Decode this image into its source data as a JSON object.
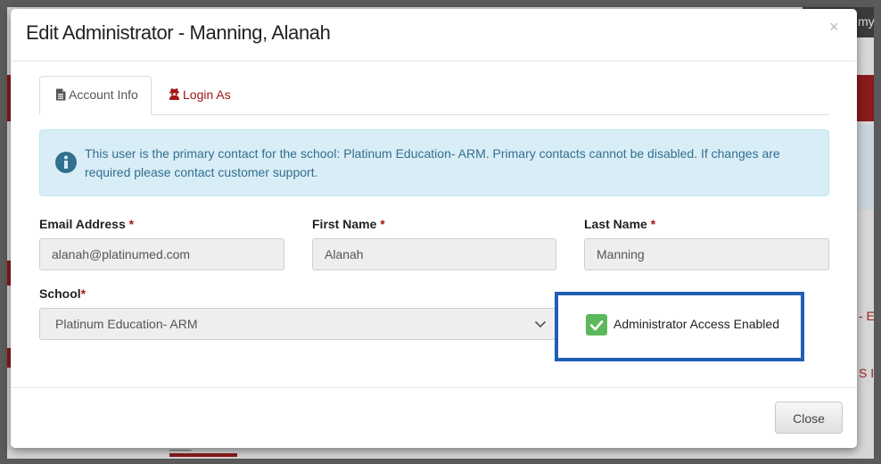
{
  "background": {
    "topbar_text": "my",
    "side_text_1": "- E",
    "side_text_2": "S I",
    "bottom_text": "____"
  },
  "modal": {
    "title": "Edit Administrator - Manning, Alanah",
    "close_icon": "×",
    "tabs": [
      {
        "label": "Account Info",
        "icon": "document-icon",
        "active": true
      },
      {
        "label": "Login As",
        "icon": "user-secret-icon",
        "active": false
      }
    ],
    "alert": {
      "icon": "info-circle-icon",
      "message": "This user is the primary contact for the school: Platinum Education- ARM. Primary contacts cannot be disabled. If changes are required please contact customer support."
    },
    "fields": {
      "email": {
        "label": "Email Address",
        "required_mark": "*",
        "value": "alanah@platinumed.com"
      },
      "first_name": {
        "label": "First Name",
        "required_mark": "*",
        "value": "Alanah"
      },
      "last_name": {
        "label": "Last Name",
        "required_mark": "*",
        "value": "Manning"
      },
      "school": {
        "label": "School",
        "required_mark": "*",
        "value": "Platinum Education- ARM"
      }
    },
    "admin_access": {
      "label": "Administrator Access Enabled",
      "checked": true
    },
    "footer": {
      "close_label": "Close"
    }
  },
  "colors": {
    "accent_red": "#a11616",
    "alert_bg": "#d9edf7",
    "alert_text": "#31708f",
    "checkbox_green": "#5cb85c",
    "highlight_blue": "#1f5fb4"
  }
}
